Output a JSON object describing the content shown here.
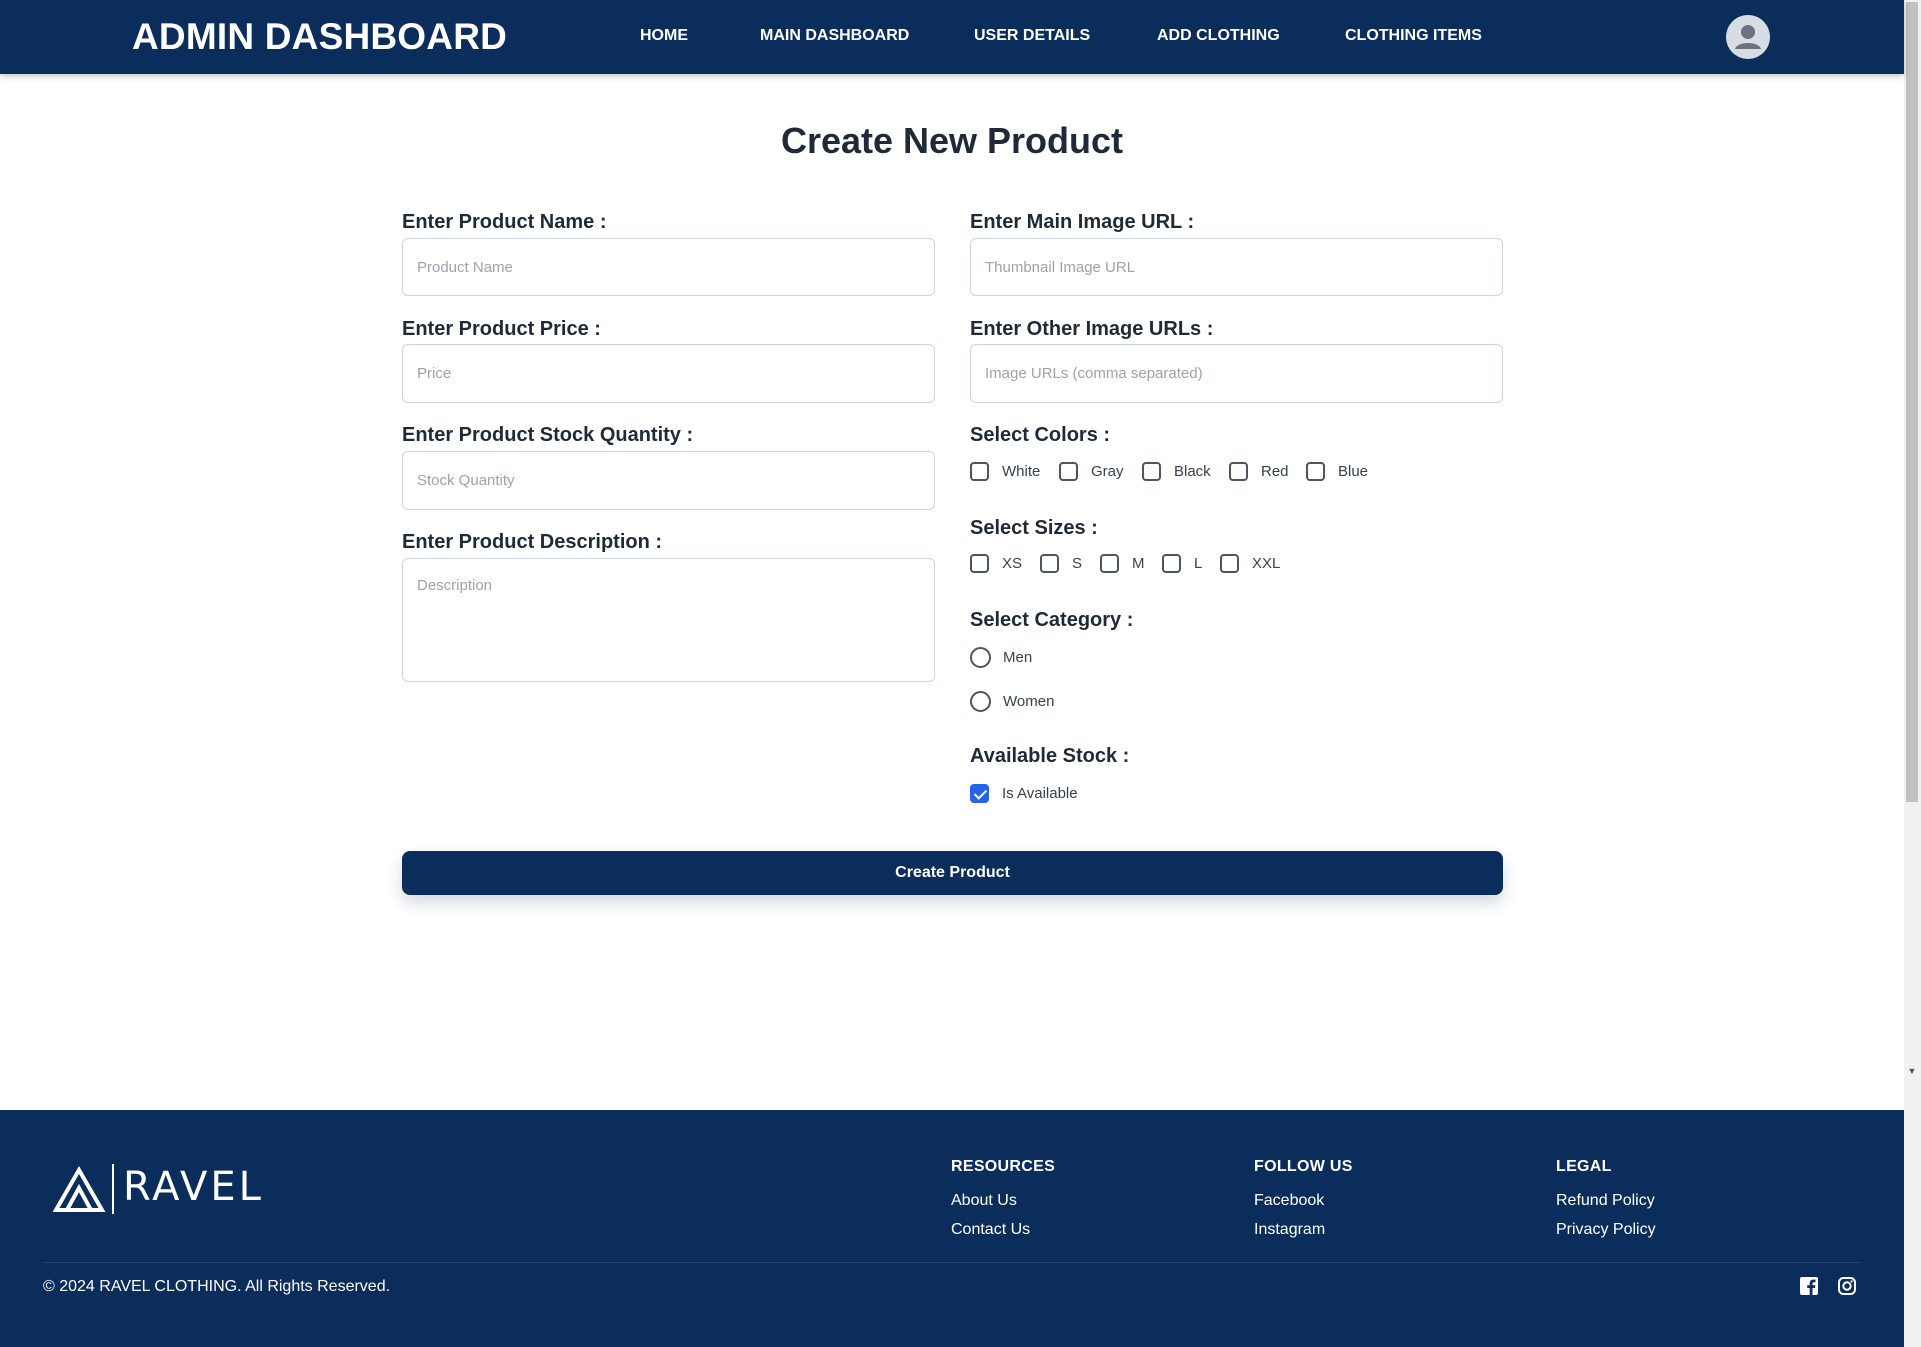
{
  "navbar": {
    "brand": "ADMIN DASHBOARD",
    "links": [
      "HOME",
      "MAIN DASHBOARD",
      "USER DETAILS",
      "ADD CLOTHING",
      "CLOTHING ITEMS"
    ],
    "avatar_icon": "user-avatar-icon"
  },
  "form": {
    "title": "Create New Product",
    "product_name": {
      "label": "Enter Product Name :",
      "placeholder": "Product Name",
      "value": ""
    },
    "product_price": {
      "label": "Enter Product Price :",
      "placeholder": "Price",
      "value": ""
    },
    "stock_quantity": {
      "label": "Enter Product Stock Quantity :",
      "placeholder": "Stock Quantity",
      "value": ""
    },
    "description": {
      "label": "Enter Product Description :",
      "placeholder": "Description",
      "value": ""
    },
    "main_image": {
      "label": "Enter Main Image URL :",
      "placeholder": "Thumbnail Image URL",
      "value": ""
    },
    "other_images": {
      "label": "Enter Other Image URLs :",
      "placeholder": "Image URLs (comma separated)",
      "value": ""
    },
    "colors": {
      "label": "Select Colors :",
      "options": [
        {
          "label": "White",
          "checked": false
        },
        {
          "label": "Gray",
          "checked": false
        },
        {
          "label": "Black",
          "checked": false
        },
        {
          "label": "Red",
          "checked": false
        },
        {
          "label": "Blue",
          "checked": false
        }
      ]
    },
    "sizes": {
      "label": "Select Sizes :",
      "options": [
        {
          "label": "XS",
          "checked": false
        },
        {
          "label": "S",
          "checked": false
        },
        {
          "label": "M",
          "checked": false
        },
        {
          "label": "L",
          "checked": false
        },
        {
          "label": "XXL",
          "checked": false
        }
      ]
    },
    "category": {
      "label": "Select Category :",
      "options": [
        {
          "label": "Men",
          "selected": false
        },
        {
          "label": "Women",
          "selected": false
        }
      ]
    },
    "stock": {
      "label": "Available Stock :",
      "option": {
        "label": "Is Available",
        "checked": true
      }
    },
    "submit_label": "Create Product"
  },
  "footer": {
    "logo_text": "RAVEL",
    "resources": {
      "heading": "RESOURCES",
      "links": [
        "About Us",
        "Contact Us"
      ]
    },
    "follow": {
      "heading": "FOLLOW US",
      "links": [
        "Facebook",
        "Instagram"
      ]
    },
    "legal": {
      "heading": "LEGAL",
      "links": [
        "Refund Policy",
        "Privacy Policy"
      ]
    },
    "copyright": "© 2024 RAVEL CLOTHING. All Rights Reserved.",
    "social_icons": [
      "facebook-icon",
      "instagram-icon"
    ]
  },
  "colors": {
    "primary": "#0b2d5b",
    "checkbox_checked": "#2563eb",
    "text": "#1f2937"
  }
}
